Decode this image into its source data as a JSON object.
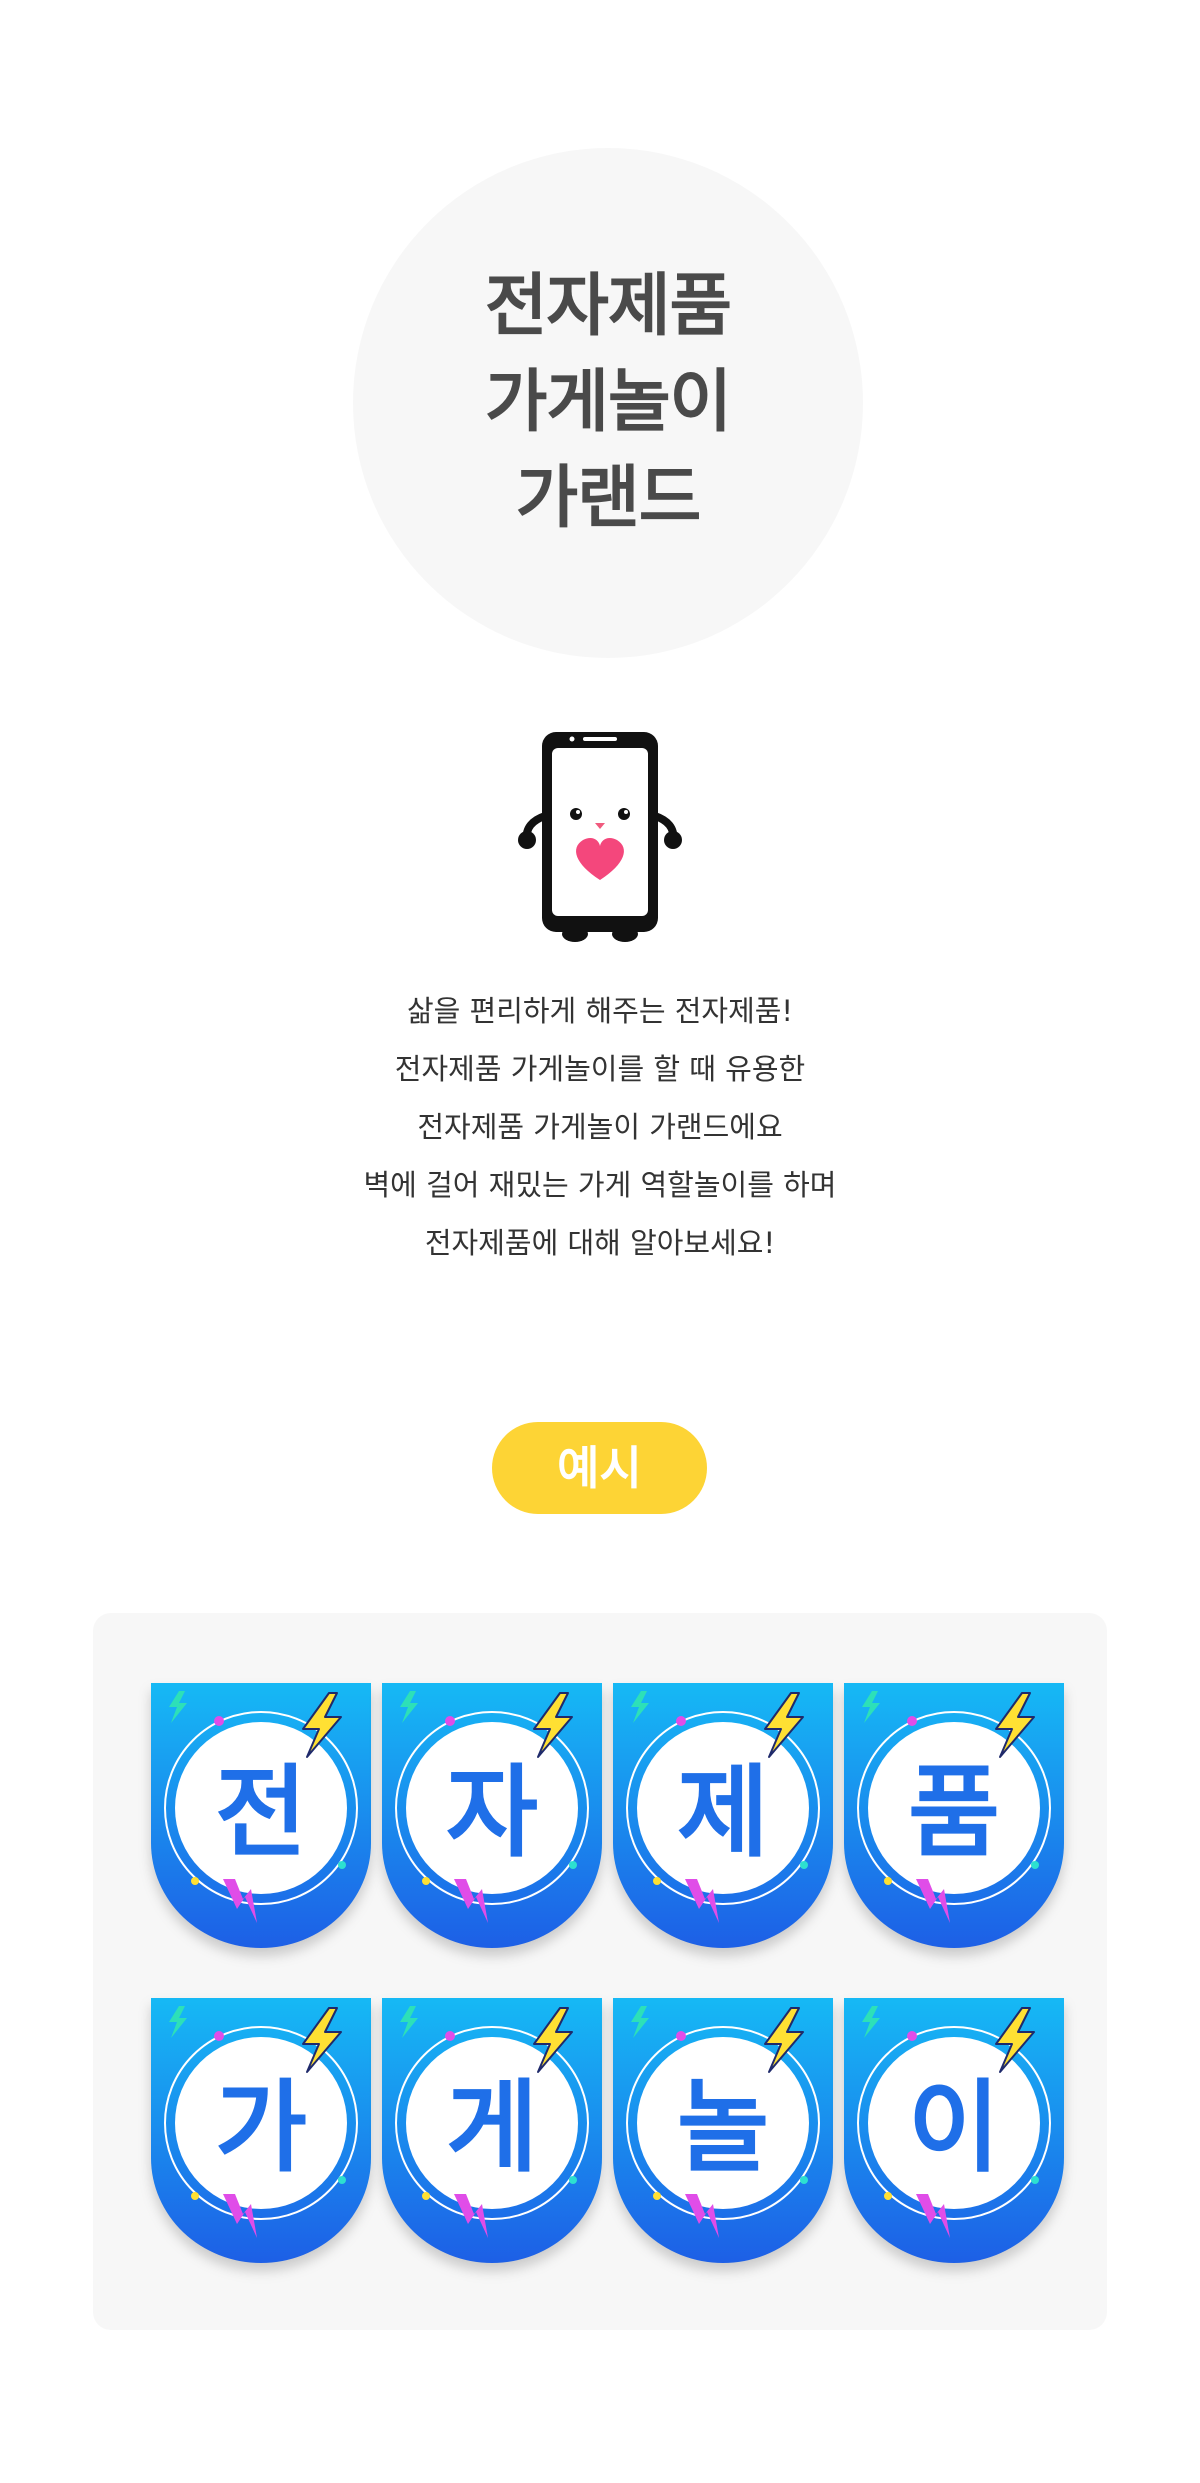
{
  "title": {
    "lines": [
      "전자제품",
      "가게놀이",
      "가랜드"
    ]
  },
  "mascot": {
    "icon": "smartphone-heart-mascot-icon"
  },
  "intro": {
    "lines": [
      "삶을 편리하게 해주는 전자제품!",
      "전자제품 가게놀이를 할 때 유용한",
      "전자제품 가게놀이 가랜드에요",
      "벽에 걸어 재밌는 가게 역할놀이를 하며",
      "전자제품에 대해 알아보세요!"
    ]
  },
  "example": {
    "label": "예시",
    "flags": [
      "전",
      "자",
      "제",
      "품",
      "가",
      "게",
      "놀",
      "이"
    ]
  },
  "colors": {
    "accent_yellow": "#fdd435",
    "flag_blue": "#1f6fe8",
    "panel_bg": "#f7f7f7"
  }
}
